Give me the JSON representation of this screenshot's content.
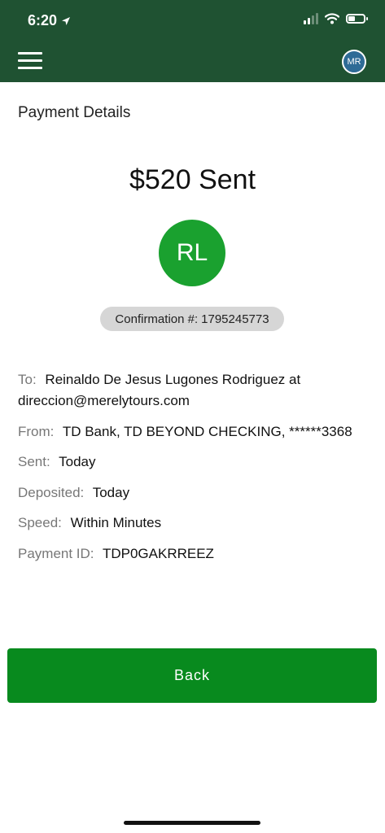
{
  "status_bar": {
    "time": "6:20"
  },
  "header": {
    "avatar_initials": "MR"
  },
  "page": {
    "title": "Payment Details"
  },
  "summary": {
    "amount_text": "$520 Sent",
    "recipient_initials": "RL",
    "confirmation_label": "Confirmation #:",
    "confirmation_number": "1795245773"
  },
  "details": [
    {
      "label": "To:",
      "value": "Reinaldo De Jesus Lugones Rodriguez at direccion@merelytours.com"
    },
    {
      "label": "From:",
      "value": "TD Bank, TD BEYOND CHECKING, ******3368"
    },
    {
      "label": "Sent:",
      "value": "Today"
    },
    {
      "label": "Deposited:",
      "value": "Today"
    },
    {
      "label": "Speed:",
      "value": "Within Minutes"
    },
    {
      "label": "Payment ID:",
      "value": "TDP0GAKRREEZ"
    }
  ],
  "actions": {
    "back_label": "Back"
  },
  "colors": {
    "header_bg": "#1f5232",
    "accent_green": "#088A1E",
    "recipient_circle": "#1aa12f",
    "confirmation_pill": "#d6d6d6"
  },
  "icons": {
    "menu": "hamburger-menu-icon",
    "location": "location-arrow-icon",
    "signal": "cellular-signal-icon",
    "wifi": "wifi-icon",
    "battery": "battery-icon"
  }
}
